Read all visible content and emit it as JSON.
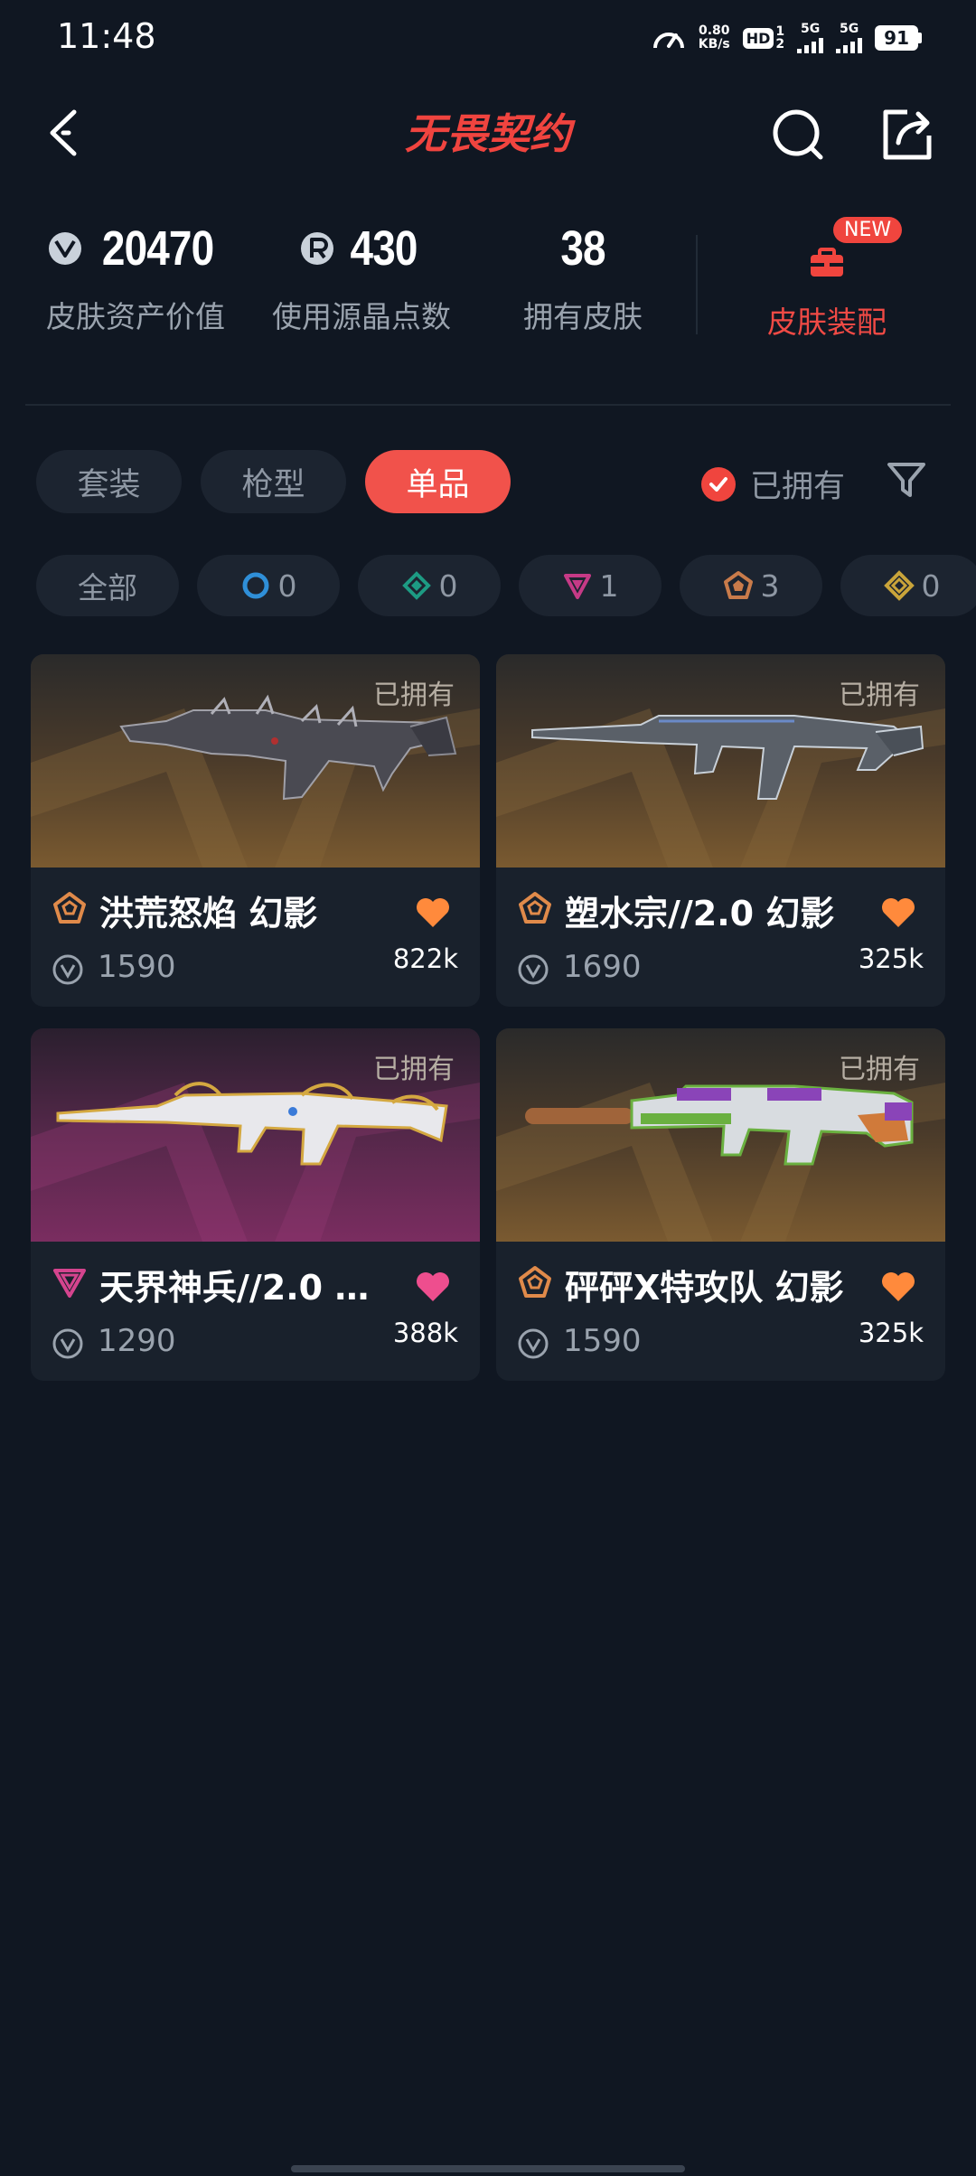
{
  "status_bar": {
    "time": "11:48",
    "net_speed_value": "0.80",
    "net_speed_unit": "KB/s",
    "hd_label": "HD",
    "hd_sub_top": "1",
    "hd_sub_bottom": "2",
    "signal1_label": "5G",
    "signal2_label": "5G",
    "battery": "91"
  },
  "header": {
    "logo_text": "无畏契约"
  },
  "stats": [
    {
      "value": "20470",
      "label": "皮肤资产价值",
      "icon": "vp-icon"
    },
    {
      "value": "430",
      "label": "使用源晶点数",
      "icon": "radianite-icon"
    },
    {
      "value": "38",
      "label": "拥有皮肤",
      "icon": ""
    }
  ],
  "skin_config": {
    "badge": "NEW",
    "label": "皮肤装配"
  },
  "tabs": [
    {
      "label": "套装",
      "active": false
    },
    {
      "label": "枪型",
      "active": false
    },
    {
      "label": "单品",
      "active": true
    }
  ],
  "owned_filter": {
    "label": "已拥有",
    "checked": true
  },
  "rarity_chips": [
    {
      "label": "全部",
      "icon": "",
      "count": ""
    },
    {
      "label": "",
      "icon": "select-tier-icon",
      "color": "#2f8fd8",
      "count": "0"
    },
    {
      "label": "",
      "icon": "deluxe-tier-icon",
      "color": "#1d9b83",
      "count": "0"
    },
    {
      "label": "",
      "icon": "premium-tier-icon",
      "color": "#c63a86",
      "count": "1"
    },
    {
      "label": "",
      "icon": "exclusive-tier-icon",
      "color": "#c97b4a",
      "count": "3"
    },
    {
      "label": "",
      "icon": "ultra-tier-icon",
      "color": "#c9a43a",
      "count": "0"
    }
  ],
  "cards": [
    {
      "name": "洪荒怒焰 幻影",
      "price": "1590",
      "likes": "822k",
      "owned": "已拥有",
      "tier_color": "#e08a4a",
      "heart_color": "#ff8a3c",
      "bg": "orange"
    },
    {
      "name": "塑水宗//2.0 幻影",
      "price": "1690",
      "likes": "325k",
      "owned": "已拥有",
      "tier_color": "#e08a4a",
      "heart_color": "#ff8a3c",
      "bg": "orange"
    },
    {
      "name": "天界神兵//2.0 幻...",
      "price": "1290",
      "likes": "388k",
      "owned": "已拥有",
      "tier_color": "#d5448e",
      "heart_color": "#ee4e8e",
      "bg": "pink"
    },
    {
      "name": "砰砰X特攻队 幻影",
      "price": "1590",
      "likes": "325k",
      "owned": "已拥有",
      "tier_color": "#e08a4a",
      "heart_color": "#ff8a3c",
      "bg": "orange"
    }
  ]
}
